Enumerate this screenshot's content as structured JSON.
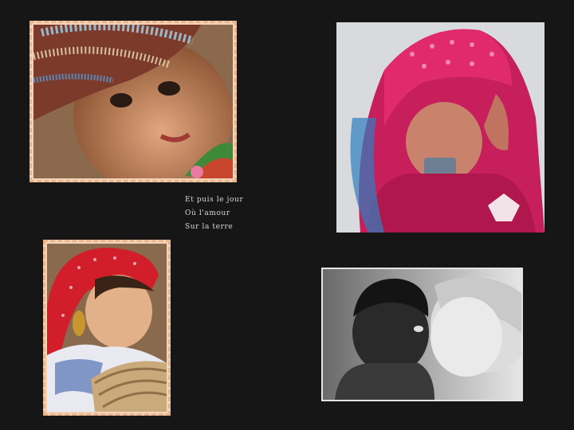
{
  "poem": {
    "lines": [
      "Et puis le jour",
      "Où l'amour",
      "Sur la terre"
    ]
  },
  "photos": [
    {
      "id": "photo-1",
      "subject": "child-beaded-headdress"
    },
    {
      "id": "photo-2",
      "subject": "child-pink-headscarf"
    },
    {
      "id": "photo-3",
      "subject": "girl-red-headscarf-basket"
    },
    {
      "id": "photo-4",
      "subject": "two-children-black-and-white"
    }
  ]
}
